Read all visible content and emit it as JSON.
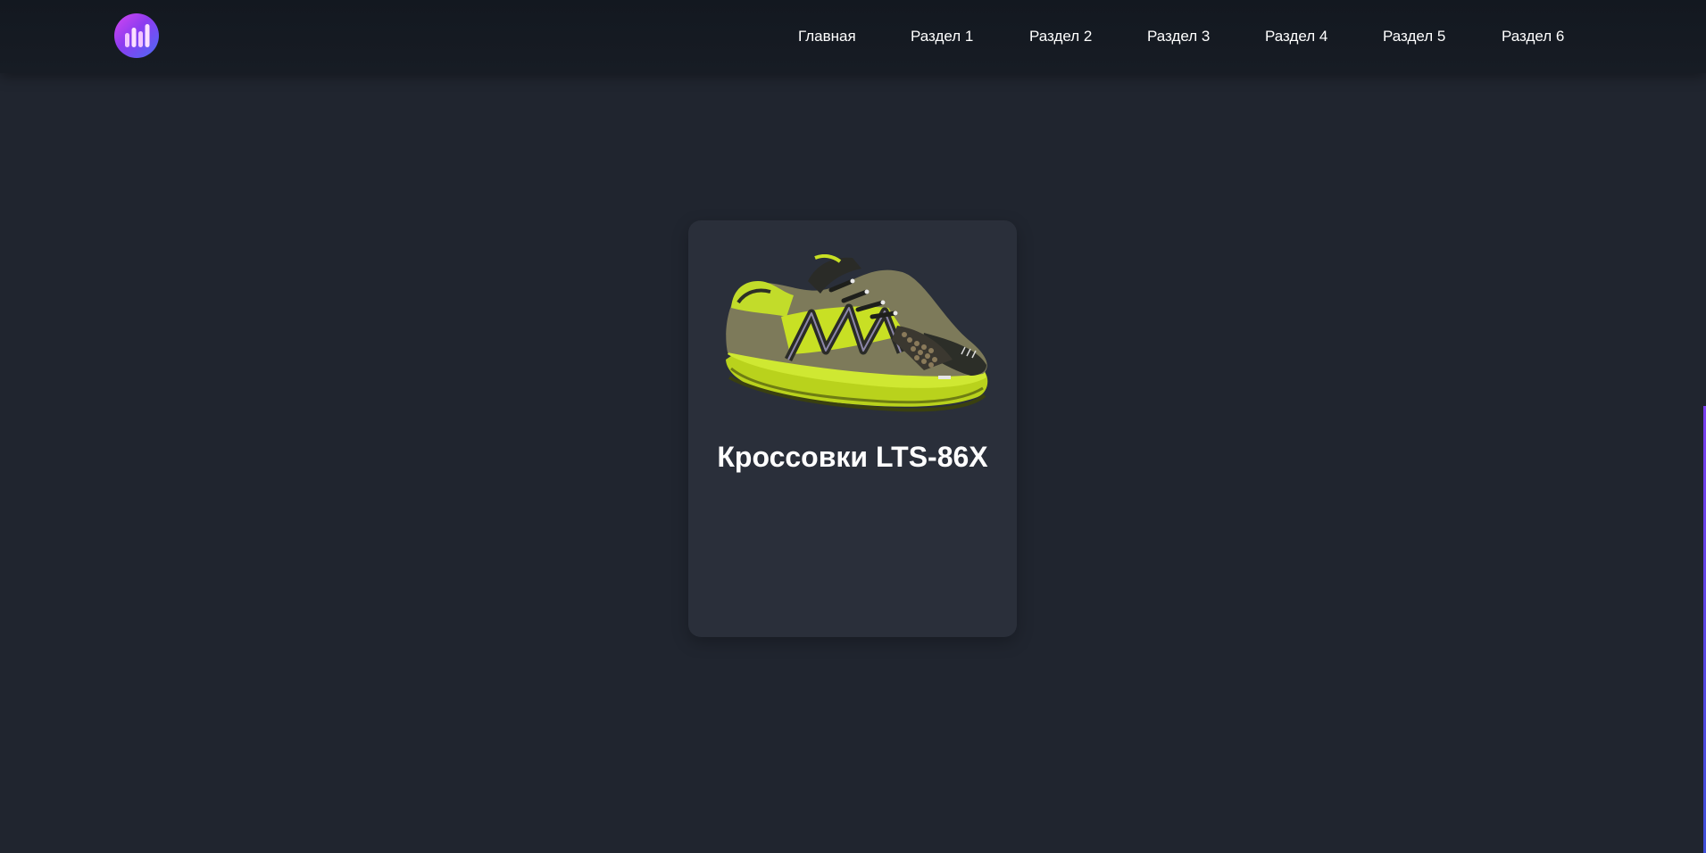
{
  "header": {
    "logo_icon": "bar-chart-logo-icon",
    "nav": [
      {
        "label": "Главная"
      },
      {
        "label": "Раздел 1"
      },
      {
        "label": "Раздел 2"
      },
      {
        "label": "Раздел 3"
      },
      {
        "label": "Раздел 4"
      },
      {
        "label": "Раздел 5"
      },
      {
        "label": "Раздел 6"
      }
    ]
  },
  "product": {
    "title": "Кроссовки LTS-86X",
    "image_icon": "sneaker-image"
  },
  "colors": {
    "header_bg": "#151a22",
    "page_bg": "#20252f",
    "card_bg": "#2a2f3a",
    "shoe_accent": "#c8e024",
    "logo_gradient": [
      "#d646f0",
      "#4a6cf5"
    ]
  }
}
